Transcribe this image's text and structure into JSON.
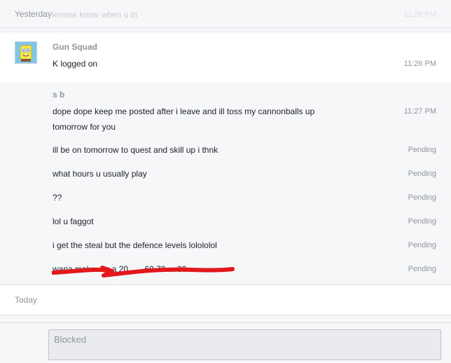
{
  "top_divider": {
    "day_label": "Yesterday",
    "ghost_text": "lemme know when u in",
    "ghost_time": "11:26 PM"
  },
  "gun_squad": {
    "sender": "Gun Squad",
    "avatar_icon": "spongebob-avatar-icon",
    "message": {
      "text": "K logged on",
      "time": "11:26 PM"
    }
  },
  "sb": {
    "sender": "s b",
    "messages": [
      {
        "text": "dope dope keep me posted after i leave and ill toss my cannonballs up tomorrow for you",
        "time": "11:27 PM"
      },
      {
        "text": "ill be on tomorrow to quest and skill up i thnk",
        "time": "Pending"
      },
      {
        "text": "what hours u usually play",
        "time": "Pending"
      },
      {
        "text": "??",
        "time": "Pending"
      },
      {
        "text": "lol u faggot",
        "time": "Pending"
      },
      {
        "text": "i get the steal but the defence levels lolololol",
        "time": "Pending"
      },
      {
        "text": "wana make... u a 20...    .. 60 70 ... 90",
        "time": "Pending"
      }
    ]
  },
  "today_divider": {
    "day_label": "Today"
  },
  "composer": {
    "placeholder": "Blocked"
  },
  "colors": {
    "strike": "#e3181b",
    "muted": "#90949c",
    "text": "#1d2129"
  }
}
